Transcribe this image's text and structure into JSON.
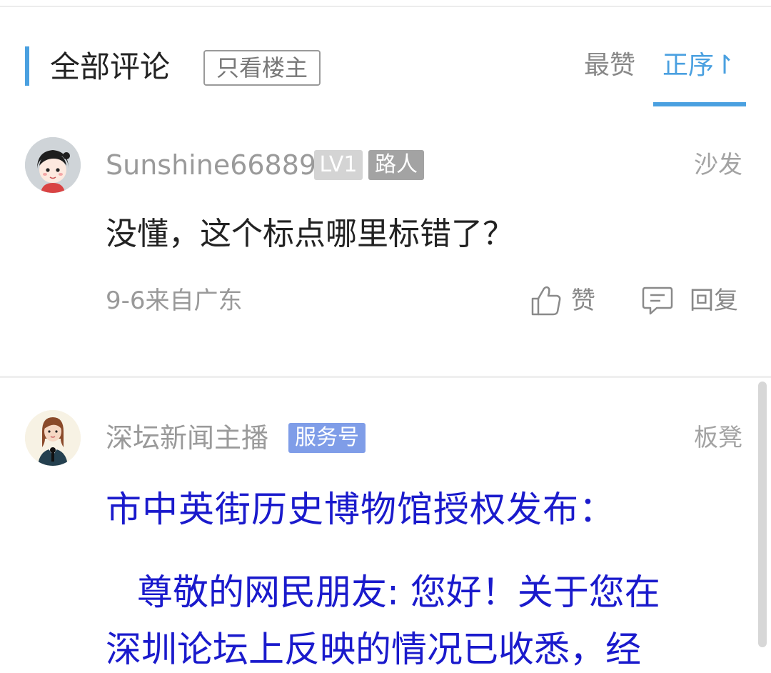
{
  "header": {
    "title": "全部评论",
    "owner_only_label": "只看楼主",
    "sort_hot_label": "最赞",
    "sort_asc_label": "正序↾",
    "accent_color": "#4aa0e0"
  },
  "comments": [
    {
      "username": "Sunshine66889",
      "level_badge": "LV1",
      "role_badge": "路人",
      "floor": "沙发",
      "text": "没懂，这个标点哪里标错了？",
      "time_location": "9-6来自广东",
      "like_label": "赞",
      "reply_label": "回复",
      "avatar_icon": "cartoon-girl-avatar"
    },
    {
      "username": "深坛新闻主播",
      "service_badge": "服务号",
      "floor": "板凳",
      "title": "市中英街历史博物馆授权发布：",
      "line2": "尊敬的网民朋友: 您好！关于您在",
      "line3": "深圳论坛上反映的情况已收悉，经",
      "text_color": "#1a1acc",
      "avatar_icon": "news-anchor-avatar"
    }
  ]
}
